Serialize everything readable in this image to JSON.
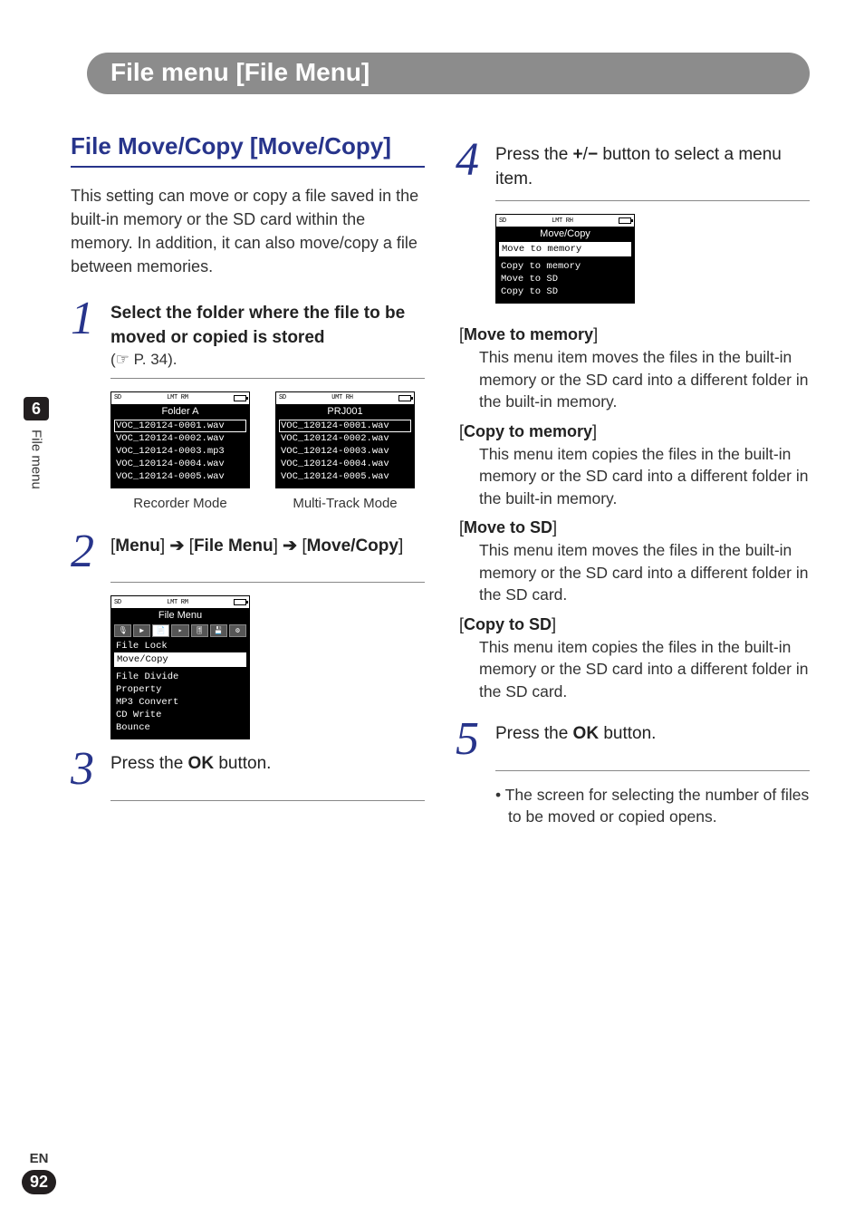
{
  "chapter": {
    "title": "File menu [File Menu]"
  },
  "section": {
    "title": "File Move/Copy [Move/Copy]"
  },
  "intro": "This setting can move or copy a file saved in the built-in memory or the SD card within the memory. In addition, it can also move/copy a file between memories.",
  "step1": {
    "num": "1",
    "title": "Select the folder where the file to be moved or copied is stored",
    "ref": "(☞ P. 34).",
    "screenA": {
      "status_left": "SD",
      "status_mid": "LMT  RM",
      "title": "Folder A",
      "items": [
        "VOC_120124-0001.wav",
        "VOC_120124-0002.wav",
        "VOC_120124-0003.mp3",
        "VOC_120124-0004.wav",
        "VOC_120124-0005.wav"
      ],
      "caption": "Recorder Mode"
    },
    "screenB": {
      "status_left": "SD",
      "status_mid": "UMT  RH",
      "title": "PRJ001",
      "items": [
        "VOC_120124-0001.wav",
        "VOC_120124-0002.wav",
        "VOC_120124-0003.wav",
        "VOC_120124-0004.wav",
        "VOC_120124-0005.wav"
      ],
      "caption": "Multi-Track Mode"
    }
  },
  "step2": {
    "num": "2",
    "path_parts": {
      "a": "Menu",
      "b": "File Menu",
      "c": "Move/Copy"
    },
    "screen": {
      "status_left": "SD",
      "status_mid": "LMT  RM",
      "title": "File Menu",
      "icons": [
        "🎙",
        "▶",
        "📄",
        "▸",
        "🎚",
        "💾",
        "⚙"
      ],
      "items": [
        "File Lock",
        "Move/Copy",
        "File Divide",
        "Property",
        "MP3 Convert",
        "CD Write",
        "Bounce"
      ],
      "selected_index": 1
    }
  },
  "step3": {
    "num": "3",
    "text_prefix": "Press the ",
    "ok": "OK",
    "text_suffix": " button."
  },
  "step4": {
    "num": "4",
    "text_a": "Press the ",
    "plus": "+",
    "slash": "/",
    "minus": "−",
    "text_b": " button to select a menu item.",
    "screen": {
      "status_left": "SD",
      "status_mid": "LMT  RH",
      "title": "Move/Copy",
      "items": [
        "Move to memory",
        "Copy to memory",
        "Move to SD",
        "Copy to SD"
      ],
      "selected_index": 0
    },
    "options": [
      {
        "label": "Move to memory",
        "desc": "This menu item moves the files in the built-in memory or the SD card into a different folder in the built-in memory."
      },
      {
        "label": "Copy to memory",
        "desc": "This menu item copies the files in the built-in memory or the SD card into a different folder in the built-in memory."
      },
      {
        "label": "Move to SD",
        "desc": "This menu item moves the files in the built-in memory or the SD card into a different folder in the SD card."
      },
      {
        "label": "Copy to SD",
        "desc": "This menu item copies the files in the built-in memory or the SD card into a different folder in the SD card."
      }
    ]
  },
  "step5": {
    "num": "5",
    "text_prefix": "Press the ",
    "ok": "OK",
    "text_suffix": " button.",
    "bullet": "• The screen for selecting the number of files to be moved or copied opens."
  },
  "side": {
    "num": "6",
    "label": "File menu"
  },
  "footer": {
    "lang": "EN",
    "page": "92"
  }
}
